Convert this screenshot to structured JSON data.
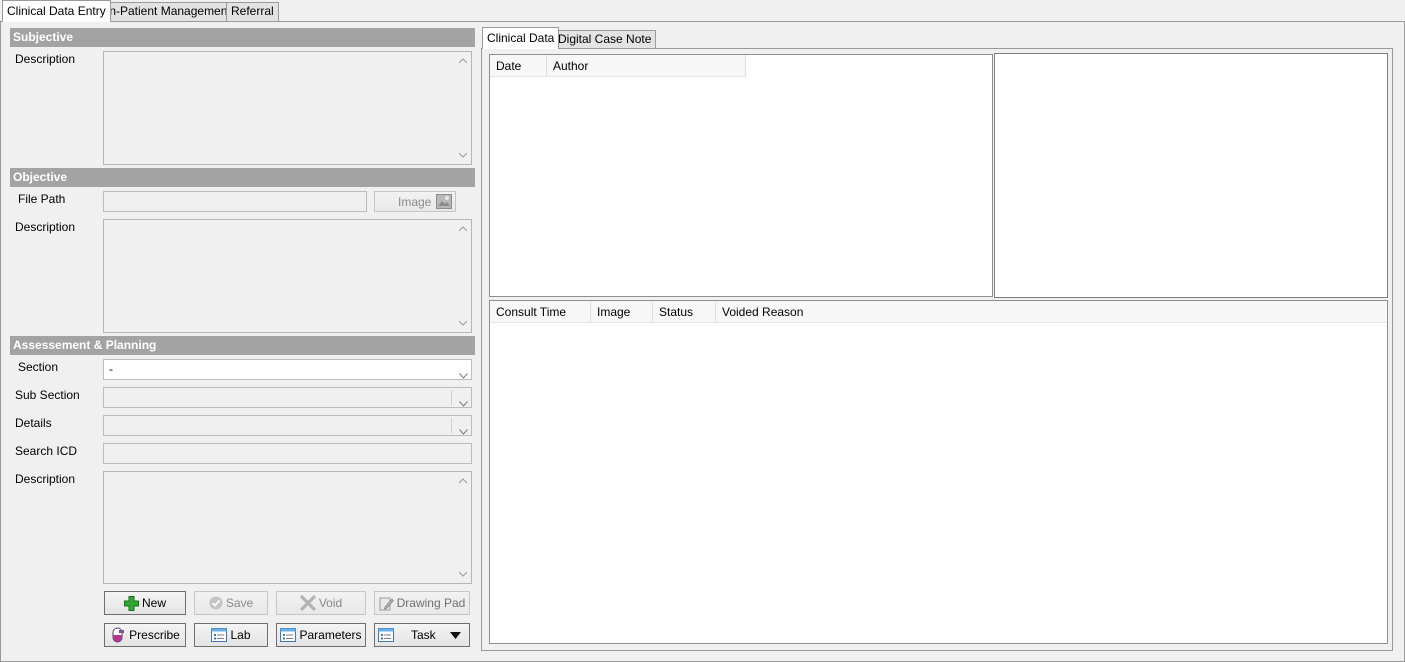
{
  "top_tabs": [
    "Clinical Data Entry",
    "In-Patient Management",
    "Referral"
  ],
  "subjective": {
    "title": "Subjective",
    "description_label": "Description",
    "description_value": ""
  },
  "objective": {
    "title": "Objective",
    "file_path_label": "File Path",
    "file_path_value": "",
    "image_button": "Image",
    "description_label": "Description",
    "description_value": ""
  },
  "assessment": {
    "title": "Assessement & Planning",
    "section_label": "Section",
    "section_value": "-",
    "subsection_label": "Sub Section",
    "subsection_value": "",
    "details_label": "Details",
    "details_value": "",
    "search_icd_label": "Search ICD",
    "search_icd_value": "",
    "description_label": "Description",
    "description_value": ""
  },
  "buttons": {
    "new": "New",
    "save": "Save",
    "void": "Void",
    "drawing_pad": "Drawing Pad",
    "prescribe": "Prescribe",
    "lab": "Lab",
    "parameters": "Parameters",
    "task": "Task"
  },
  "right_tabs": [
    "Clinical Data",
    "Digital Case Note"
  ],
  "clinical_table": {
    "columns": [
      "Date",
      "Author"
    ],
    "rows": []
  },
  "consult_table": {
    "columns": [
      "Consult Time",
      "Image",
      "Status",
      "Voided Reason"
    ],
    "rows": []
  },
  "icons": {
    "new": "plus-icon",
    "save": "check-circle-icon",
    "void": "x-icon",
    "drawing_pad": "pencil-pad-icon",
    "prescribe": "capsule-icon",
    "lab": "form-icon",
    "parameters": "form-icon",
    "task": "form-icon",
    "image": "image-icon"
  },
  "colors": {
    "section_header_bg": "#a3a3a3",
    "new_icon": "#2ea82e"
  }
}
